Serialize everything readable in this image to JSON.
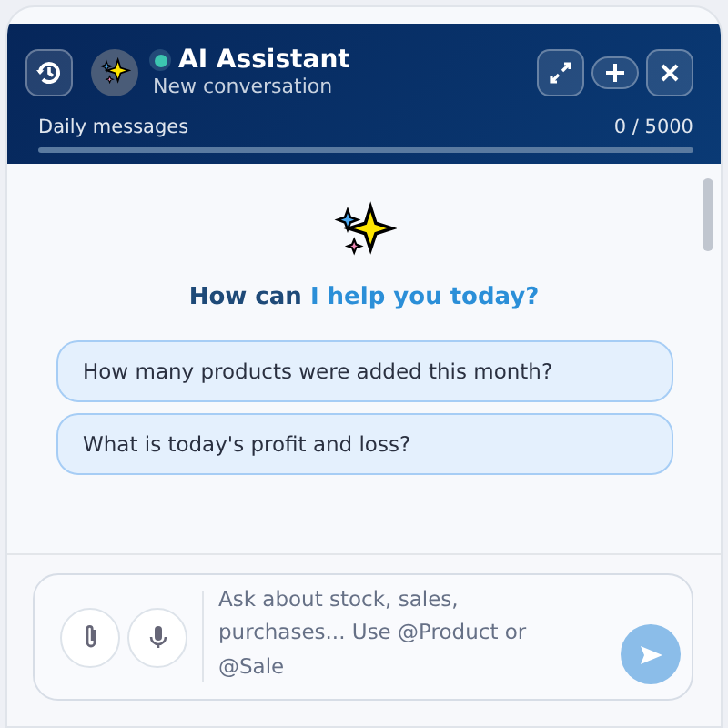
{
  "header": {
    "title": "AI Assistant",
    "subtitle": "New conversation",
    "online": true,
    "usage": {
      "label": "Daily messages",
      "count": "0 / 5000",
      "level": 0
    }
  },
  "greeting": {
    "lead": "How can",
    "highlight": "I help you today?"
  },
  "suggestions": [
    "How many products were added this month?",
    "What is today's profit and loss?"
  ],
  "composer": {
    "placeholder": "Ask about stock, sales, purchases... Use @Product or @Sale",
    "send_disabled": true
  }
}
